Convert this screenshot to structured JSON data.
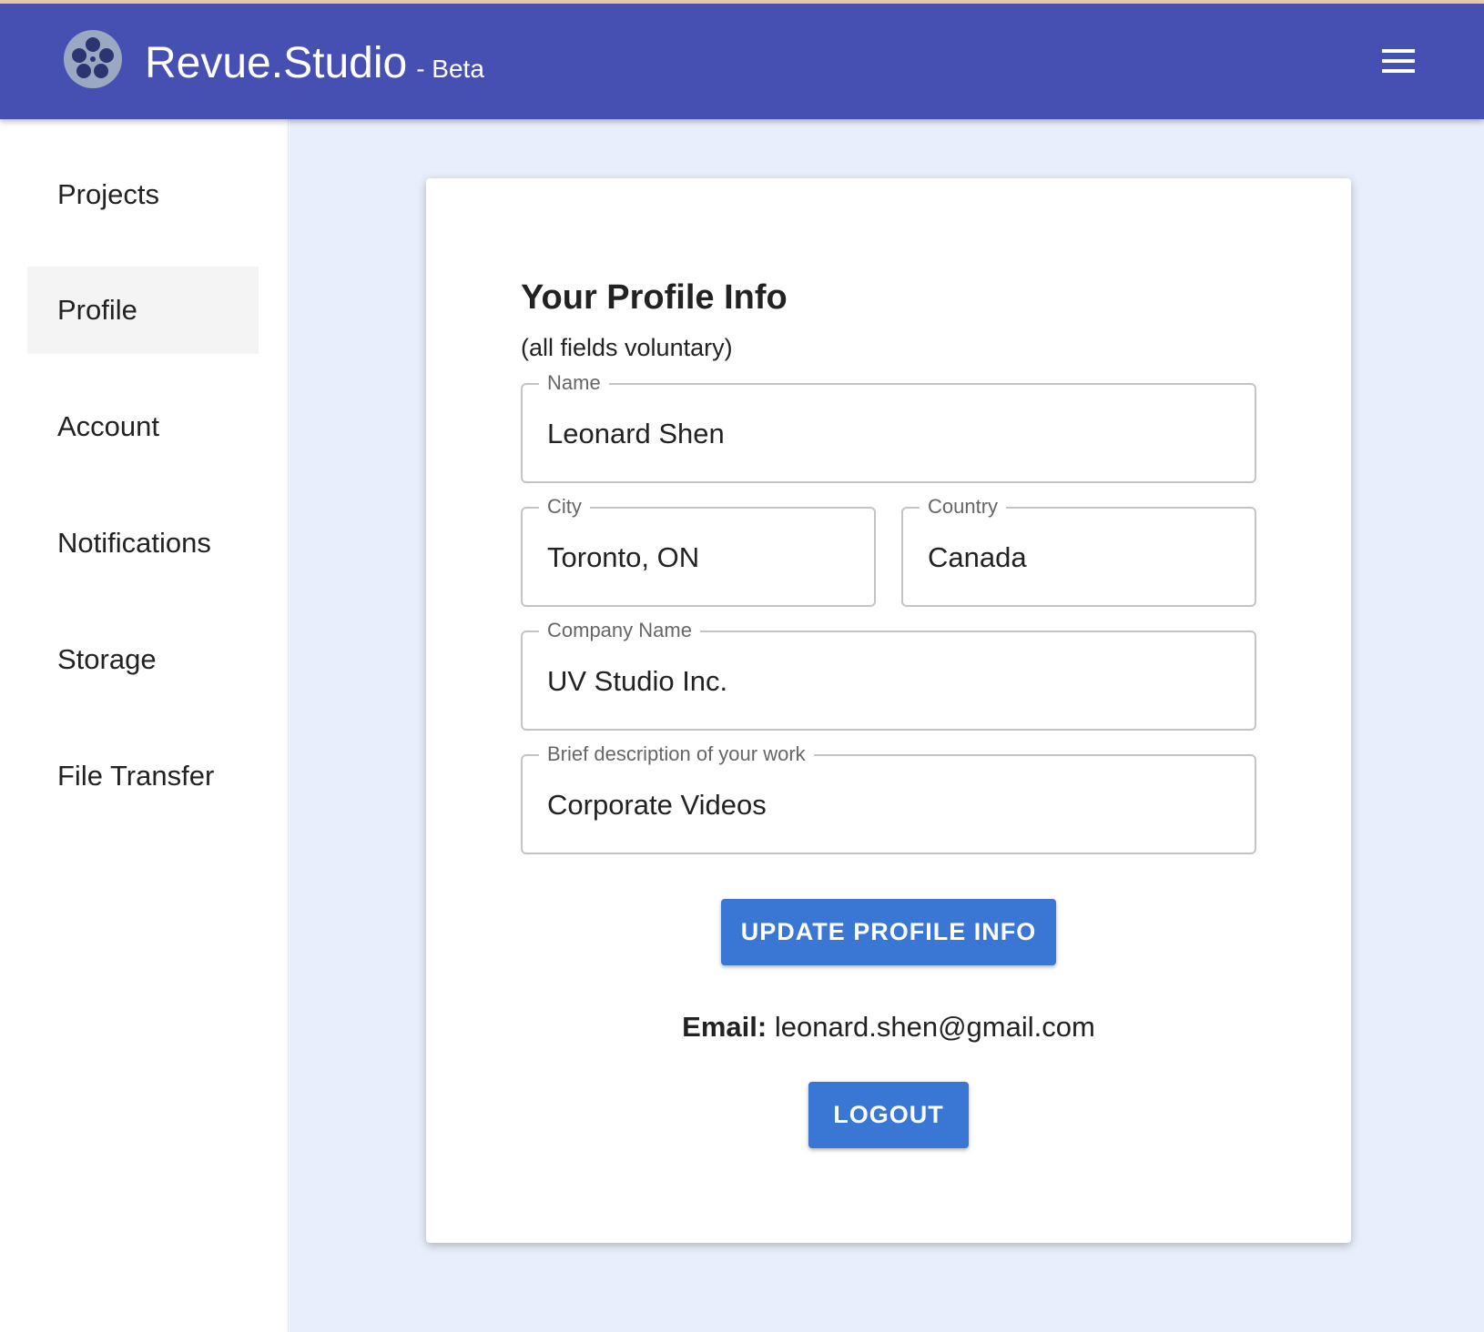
{
  "app": {
    "title": "Revue.Studio",
    "subtitle": "- Beta",
    "logo_icon": "film-reel-icon",
    "menu_icon": "hamburger-menu-icon",
    "colors": {
      "appbar": "#4650b3",
      "main_bg": "#e8eefb",
      "button": "#3a76d3",
      "active_nav": "#f4f4f4"
    }
  },
  "sidebar": {
    "items": [
      {
        "label": "Projects",
        "active": false
      },
      {
        "label": "Profile",
        "active": true
      },
      {
        "label": "Account",
        "active": false
      },
      {
        "label": "Notifications",
        "active": false
      },
      {
        "label": "Storage",
        "active": false
      },
      {
        "label": "File Transfer",
        "active": false
      }
    ]
  },
  "profile": {
    "title": "Your Profile Info",
    "subtitle": "(all fields voluntary)",
    "fields": {
      "name": {
        "label": "Name",
        "value": "Leonard Shen"
      },
      "city": {
        "label": "City",
        "value": "Toronto, ON"
      },
      "country": {
        "label": "Country",
        "value": "Canada"
      },
      "company": {
        "label": "Company Name",
        "value": "UV Studio Inc."
      },
      "description": {
        "label": "Brief description of your work",
        "value": "Corporate Videos"
      }
    },
    "update_button": "UPDATE PROFILE INFO",
    "email_label": "Email:",
    "email_value": "leonard.shen@gmail.com",
    "logout_button": "LOGOUT"
  }
}
